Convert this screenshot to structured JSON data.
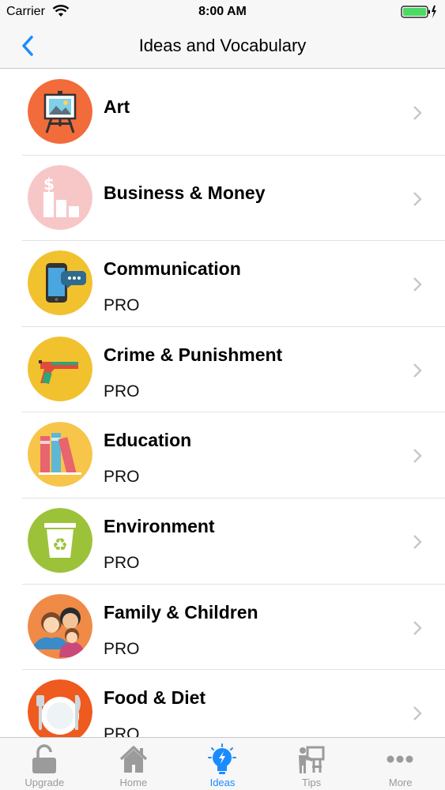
{
  "status_bar": {
    "carrier": "Carrier",
    "time": "8:00 AM"
  },
  "nav": {
    "title": "Ideas and Vocabulary"
  },
  "topics": [
    {
      "label": "Art",
      "badge": ""
    },
    {
      "label": "Business & Money",
      "badge": ""
    },
    {
      "label": "Communication",
      "badge": "PRO"
    },
    {
      "label": "Crime & Punishment",
      "badge": "PRO"
    },
    {
      "label": "Education",
      "badge": "PRO"
    },
    {
      "label": "Environment",
      "badge": "PRO"
    },
    {
      "label": "Family & Children",
      "badge": "PRO"
    },
    {
      "label": "Food & Diet",
      "badge": "PRO"
    }
  ],
  "tabs": [
    {
      "label": "Upgrade",
      "icon": "lock-icon"
    },
    {
      "label": "Home",
      "icon": "home-icon"
    },
    {
      "label": "Ideas",
      "icon": "lightbulb-icon",
      "active": true
    },
    {
      "label": "Tips",
      "icon": "teacher-board-icon"
    },
    {
      "label": "More",
      "icon": "more-dots-icon"
    }
  ],
  "colors": {
    "accent": "#1a8cff",
    "inactive_tab": "#999999",
    "separator": "#e2e2e6"
  }
}
